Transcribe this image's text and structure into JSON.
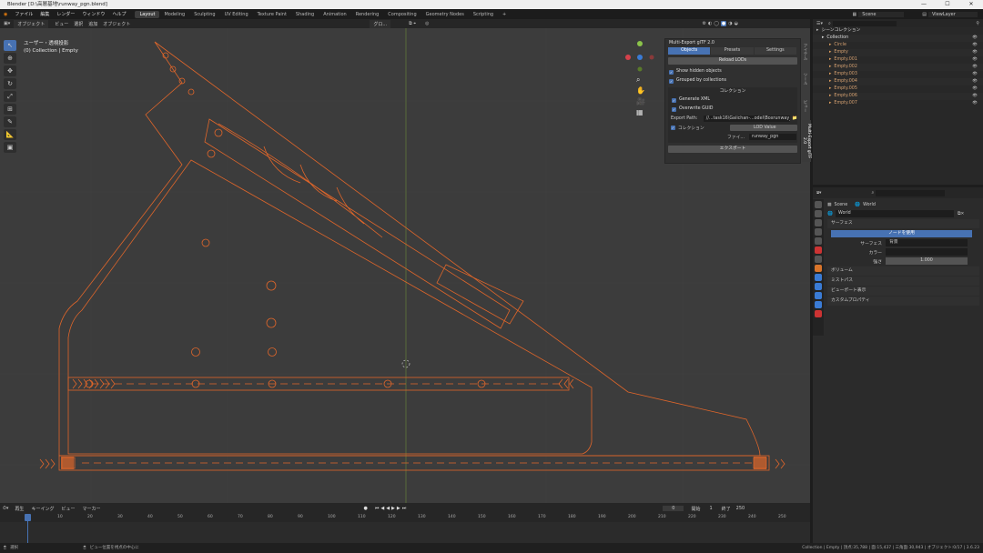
{
  "window": {
    "title": "Blender [D:\\高層基地\\runway_pgn.blend]",
    "controls": [
      "—",
      "☐",
      "✕"
    ]
  },
  "menubar": {
    "menus": [
      "ファイル",
      "編集",
      "レンダー",
      "ウィンドウ",
      "ヘルプ"
    ],
    "workspaces": [
      "Layout",
      "Modeling",
      "Sculpting",
      "UV Editing",
      "Texture Paint",
      "Shading",
      "Animation",
      "Rendering",
      "Compositing",
      "Geometry Nodes",
      "Scripting"
    ],
    "active_workspace": "Layout",
    "add_tab": "+",
    "scene_label": "Scene",
    "viewlayer_label": "ViewLayer"
  },
  "viewport_header": {
    "mode": "オブジェクト",
    "menus": [
      "ビュー",
      "選択",
      "追加",
      "オブジェクト"
    ],
    "orientation": "グロ...",
    "options": "オプション"
  },
  "viewport": {
    "view_name": "ユーザー・透視投影",
    "collection_info": "(0) Collection | Empty",
    "tools": [
      "select",
      "cursor",
      "move",
      "rotate",
      "scale",
      "transform",
      "annotate",
      "measure",
      "add-cube"
    ],
    "line_color": "#e0662a",
    "gizmo_axes": {
      "x": "#d5414b",
      "y": "#8bc34a",
      "z": "#3a7bd5"
    }
  },
  "npanel": {
    "title": "Multi-Export glTF 2.0",
    "tabs": [
      "Objects",
      "Presets",
      "Settings"
    ],
    "active_tab": "Objects",
    "reload_button": "Reload LODs",
    "show_hidden": "Show hidden objects",
    "grouped": "Grouped by collections",
    "collection_section": "コレクション",
    "generate_xml": "Generate XML",
    "overwrite_guid": "Overwrite GUID",
    "export_path_label": "Export Path:",
    "export_path_value": "//...task16\\Gaiichan-...odel\\Boxrunway_pgn\\",
    "collection_label": "コレクション",
    "lod_value": "LOD Value",
    "file_label": "ファイ...",
    "file_value": "runway_pgn",
    "export_button": "エクスポート",
    "side_tabs": [
      "アイテム",
      "ツール",
      "ビュー",
      "Multi-Export glTF 2.0"
    ]
  },
  "timeline": {
    "menus": [
      "再生",
      "キーイング",
      "ビュー",
      "マーカー"
    ],
    "current_frame": "0",
    "start_label": "開始",
    "start": "1",
    "end_label": "終了",
    "end": "250",
    "ticks": [
      "0",
      "10",
      "20",
      "30",
      "40",
      "50",
      "60",
      "70",
      "80",
      "90",
      "100",
      "110",
      "120",
      "130",
      "140",
      "150",
      "160",
      "170",
      "180",
      "190",
      "200",
      "210",
      "220",
      "230",
      "240",
      "250"
    ]
  },
  "statusbar": {
    "left": "選択",
    "center": "ビュー位置を視点の中心に",
    "right": "Collection | Empty | 頂点:35,788 | 面:15,437 | 三角面:30,943 | オブジェクト:0/17 | 3.6.23"
  },
  "outliner": {
    "search_placeholder": "",
    "root": "シーンコレクション",
    "collection": "Collection",
    "items": [
      "Circle",
      "Empty",
      "Empty.001",
      "Empty.002",
      "Empty.003",
      "Empty.004",
      "Empty.005",
      "Empty.006",
      "Empty.007"
    ]
  },
  "properties": {
    "breadcrumb_scene": "Scene",
    "breadcrumb_world": "World",
    "world_name": "World",
    "surface_section": "サーフェス",
    "use_nodes_button": "ノードを使用",
    "surface_label": "サーフェス",
    "surface_value": "背景",
    "color_label": "カラー",
    "strength_label": "強さ",
    "strength_value": "1.000",
    "sections": [
      "ボリューム",
      "ミストパス",
      "ビューポート表示",
      "カスタムプロパティ"
    ]
  }
}
